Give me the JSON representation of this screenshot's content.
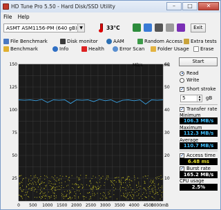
{
  "title": "HD Tune Pro 5.50 - Hard Disk/SSD Utility",
  "menu": [
    "File",
    "Help"
  ],
  "drive": "ASMT    ASM1156-PM (640 gB)",
  "temperature": "33°C",
  "exit_label": "Exit",
  "colors": {
    "chart_bg": "#1b1b1b",
    "grid": "#3a3a3a",
    "transfer_line": "#3aa0e0",
    "access_dots": "#d8d020",
    "value_cyan": "#40c0ff",
    "value_yellow": "#e8e030",
    "value_white": "#ffffff"
  },
  "tabs": {
    "file_benchmark": "File Benchmark",
    "disk_monitor": "Disk monitor",
    "aam": "AAM",
    "random_access": "Random Access",
    "extra_tests": "Extra tests",
    "benchmark": "Benchmark",
    "info": "Info",
    "health": "Health",
    "error_scan": "Error Scan",
    "folder_usage": "Folder Usage",
    "erase": "Erase"
  },
  "chart": {
    "left_unit": "MB/s",
    "right_unit": "ms",
    "left_ticks": [
      "150",
      "125",
      "100",
      "75",
      "50",
      "25"
    ],
    "right_ticks": [
      "60",
      "50",
      "40",
      "30",
      "20",
      "10"
    ],
    "x_ticks": [
      "0",
      "500",
      "1000",
      "1500",
      "2000",
      "2500",
      "3000",
      "3500",
      "4000",
      "4500",
      "5000mB"
    ]
  },
  "side": {
    "start": "Start",
    "read": "Read",
    "write": "Write",
    "short_stroke": "Short stroke",
    "stroke_value": "5",
    "stroke_unit": "gB",
    "transfer_rate": "Transfer rate",
    "minimum_label": "Minimum",
    "minimum_value": "106.3 MB/s",
    "maximum_label": "Maximum",
    "maximum_value": "112.3 MB/s",
    "average_label": "Average",
    "average_value": "110.7 MB/s",
    "access_time": "Access time",
    "access_value": "6.48 ms",
    "burst_rate": "Burst rate",
    "burst_value": "165.2 MB/s",
    "cpu_label": "CPU usage",
    "cpu_value": "2.5%"
  },
  "chart_data": {
    "type": "line",
    "xlabel": "",
    "ylabel": "MB/s",
    "y2label": "ms",
    "xlim": [
      0,
      5000
    ],
    "ylim": [
      0,
      150
    ],
    "y2lim": [
      0,
      60
    ],
    "grid": true,
    "series": [
      {
        "x": [
          0,
          200,
          400,
          600,
          800,
          1000,
          1200,
          1400,
          1600,
          1800,
          2000,
          2200,
          2400,
          2600,
          2800,
          3000,
          3200,
          3400,
          3600,
          3800,
          4000,
          4200,
          4400,
          4600,
          4800,
          5000
        ],
        "values": [
          111,
          110.5,
          111,
          110,
          111.5,
          108,
          111,
          110.5,
          111,
          107,
          111,
          110.5,
          111,
          109,
          111.5,
          110,
          111,
          108,
          110.5,
          111,
          110,
          111,
          106.3,
          111,
          110.5,
          111
        ]
      }
    ]
  }
}
